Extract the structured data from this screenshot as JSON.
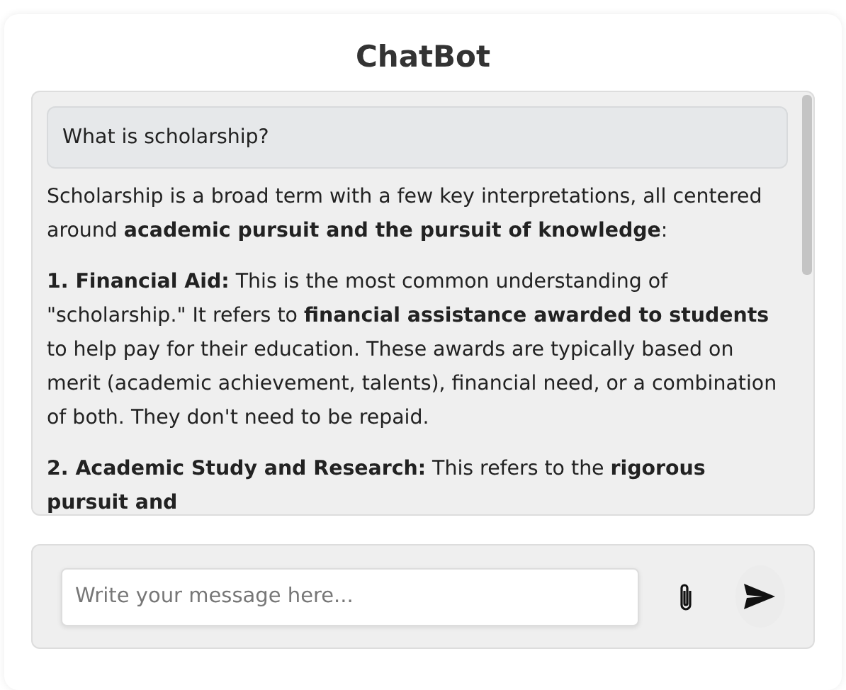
{
  "title": "ChatBot",
  "messages": [
    {
      "kind": "user",
      "text": "What is scholarship?"
    },
    {
      "kind": "bot",
      "paragraphs": [
        "Scholarship is a broad term with a few key interpretations, all centered around **academic pursuit and the pursuit of knowledge**:",
        "**1. Financial Aid:** This is the most common understanding of \"scholarship.\" It refers to **financial assistance awarded to students** to help pay for their education. These awards are typically based on merit (academic achievement, talents), financial need, or a combination of both. They don't need to be repaid.",
        "**2. Academic Study and Research:** This refers to the **rigorous pursuit and**"
      ]
    }
  ],
  "composer": {
    "placeholder": "Write your message here..."
  }
}
